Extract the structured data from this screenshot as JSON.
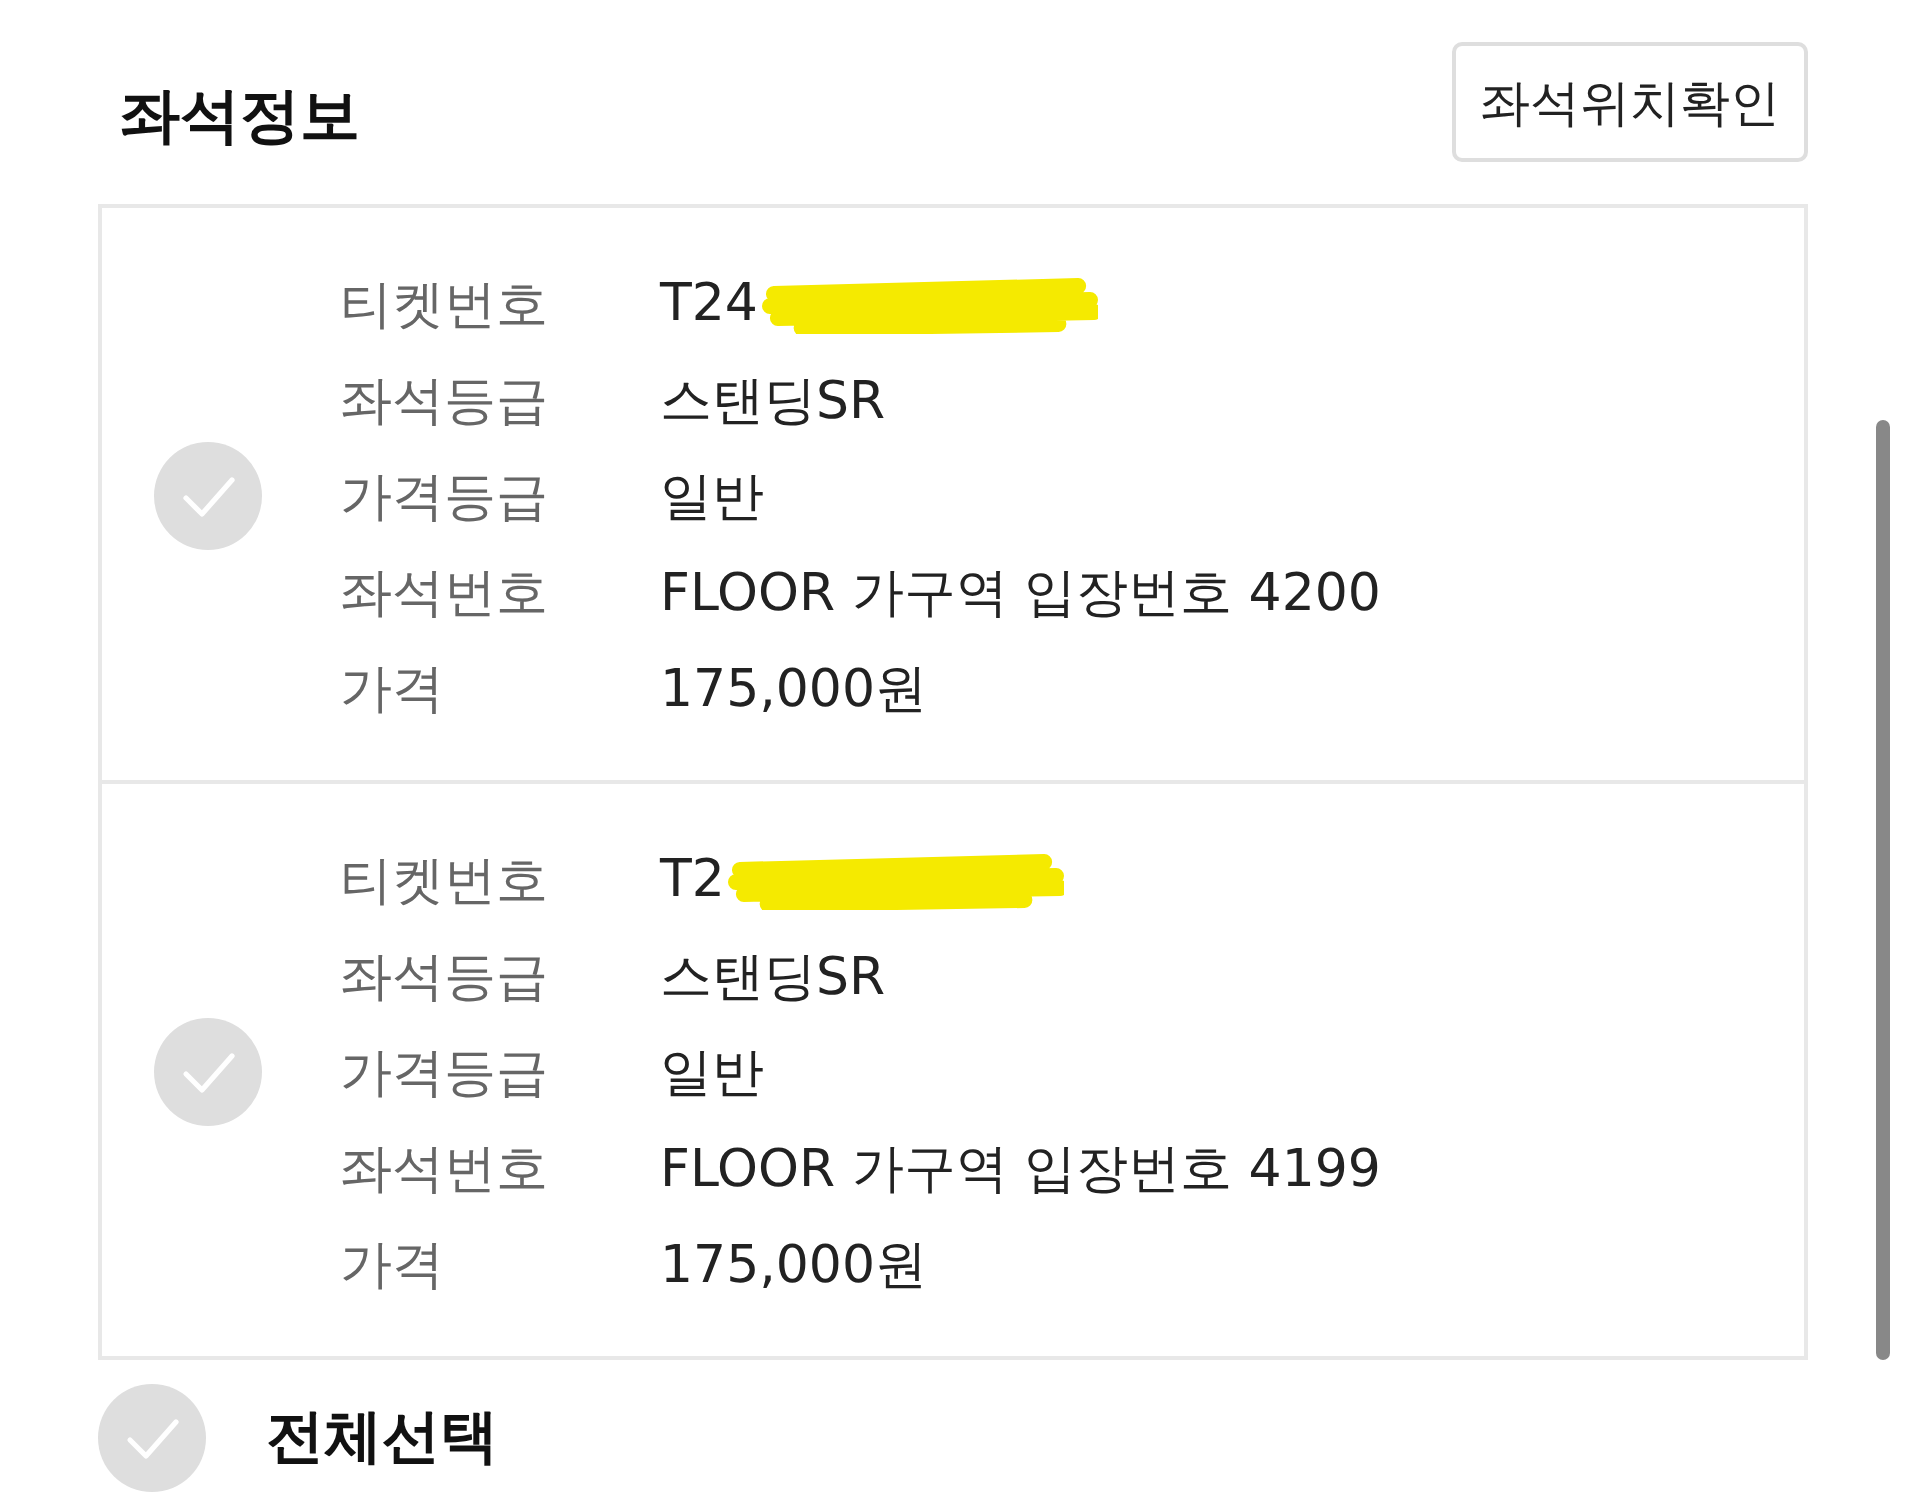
{
  "header": {
    "title": "좌석정보",
    "button": "좌석위치확인"
  },
  "tickets": [
    {
      "checked": false,
      "fields": [
        {
          "label": "티켓번호",
          "value": "T24",
          "redacted": true
        },
        {
          "label": "좌석등급",
          "value": "스탠딩SR",
          "redacted": false
        },
        {
          "label": "가격등급",
          "value": "일반",
          "redacted": false
        },
        {
          "label": "좌석번호",
          "value": "FLOOR 가구역 입장번호 4200",
          "redacted": false
        },
        {
          "label": "가격",
          "value": "175,000원",
          "redacted": false
        }
      ]
    },
    {
      "checked": false,
      "fields": [
        {
          "label": "티켓번호",
          "value": "T2",
          "redacted": true
        },
        {
          "label": "좌석등급",
          "value": "스탠딩SR",
          "redacted": false
        },
        {
          "label": "가격등급",
          "value": "일반",
          "redacted": false
        },
        {
          "label": "좌석번호",
          "value": "FLOOR 가구역 입장번호 4199",
          "redacted": false
        },
        {
          "label": "가격",
          "value": "175,000원",
          "redacted": false
        }
      ]
    }
  ],
  "select_all": {
    "label": "전체선택",
    "checked": false
  }
}
